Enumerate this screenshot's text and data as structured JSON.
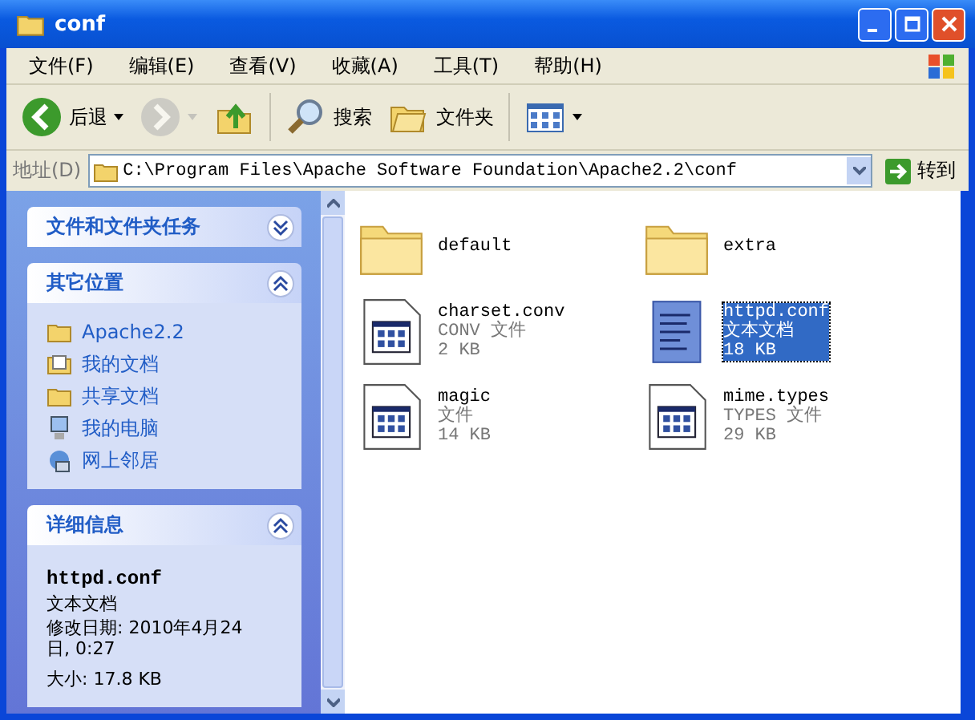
{
  "window": {
    "title": "conf"
  },
  "menu": [
    "文件(F)",
    "编辑(E)",
    "查看(V)",
    "收藏(A)",
    "工具(T)",
    "帮助(H)"
  ],
  "toolbar": [
    {
      "kind": "back",
      "label": "后退",
      "disabled": false
    },
    {
      "kind": "forward",
      "disabled": true
    },
    {
      "kind": "up",
      "disabled": false
    },
    {
      "kind": "search",
      "label": "搜索",
      "disabled": false
    },
    {
      "kind": "folders",
      "label": "文件夹",
      "disabled": false
    },
    {
      "kind": "views",
      "disabled": false
    }
  ],
  "address": {
    "label": "地址(D)",
    "value": "C:\\Program Files\\Apache Software Foundation\\Apache2.2\\conf",
    "go": "转到"
  },
  "sidebar": [
    {
      "title": "文件和文件夹任务",
      "expanded": false
    },
    {
      "title": "其它位置",
      "expanded": true,
      "items": [
        {
          "kind": "folder",
          "label": "Apache2.2"
        },
        {
          "kind": "documents",
          "label": "我的文档"
        },
        {
          "kind": "folder",
          "label": "共享文档"
        },
        {
          "kind": "computer",
          "label": "我的电脑"
        },
        {
          "kind": "network",
          "label": "网上邻居"
        }
      ]
    },
    {
      "title": "详细信息",
      "expanded": true,
      "details": {
        "name": "httpd.conf",
        "type": "文本文档",
        "modified": "修改日期: 2010年4月24日, 0:27",
        "size": "大小: 17.8 KB"
      }
    }
  ],
  "files": [
    {
      "kind": "folder",
      "name": "default",
      "selected": false
    },
    {
      "kind": "folder",
      "name": "extra",
      "selected": false
    },
    {
      "kind": "file",
      "name": "charset.conv",
      "type": "CONV 文件",
      "size": "2 KB",
      "selected": false
    },
    {
      "kind": "text",
      "name": "httpd.conf",
      "type": "文本文档",
      "size": "18 KB",
      "selected": true
    },
    {
      "kind": "file",
      "name": "magic",
      "type": "文件",
      "size": "14 KB",
      "selected": false
    },
    {
      "kind": "file",
      "name": "mime.types",
      "type": "TYPES 文件",
      "size": "29 KB",
      "selected": false
    }
  ]
}
